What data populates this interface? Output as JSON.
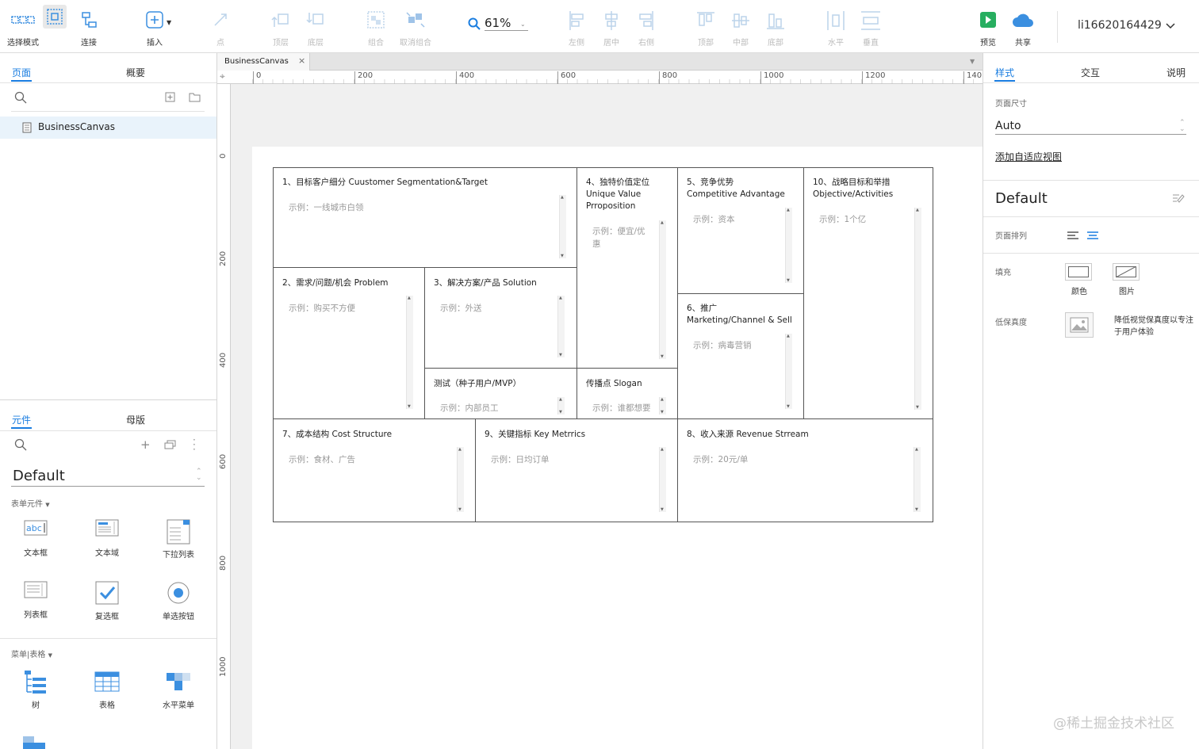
{
  "toolbar": {
    "select_mode": "选择模式",
    "connect": "连接",
    "insert": "插入",
    "point": "点",
    "top_layer": "顶层",
    "bottom_layer": "底层",
    "group": "组合",
    "ungroup": "取消组合",
    "zoom": "61%",
    "align_left": "左侧",
    "align_center": "居中",
    "align_right": "右侧",
    "align_top": "顶部",
    "align_middle": "中部",
    "align_bottom": "底部",
    "distribute_h": "水平",
    "distribute_v": "垂直",
    "preview": "预览",
    "share": "共享",
    "username": "li16620164429"
  },
  "left_panel": {
    "tabs": {
      "pages": "页面",
      "outline": "概要"
    },
    "page_item": "BusinessCanvas",
    "lib_tabs": {
      "widgets": "元件",
      "masters": "母版"
    },
    "library_name": "Default",
    "section_form": "表单元件",
    "widgets_form": [
      {
        "label": "文本框"
      },
      {
        "label": "文本域"
      },
      {
        "label": "下拉列表"
      },
      {
        "label": "列表框"
      },
      {
        "label": "复选框"
      },
      {
        "label": "单选按钮"
      }
    ],
    "section_menu": "菜单|表格",
    "widgets_menu": [
      {
        "label": "树"
      },
      {
        "label": "表格"
      },
      {
        "label": "水平菜单"
      }
    ]
  },
  "canvas": {
    "tab_title": "BusinessCanvas",
    "ruler_h": [
      "0",
      "200",
      "400",
      "600",
      "800",
      "1000",
      "1200",
      "140"
    ],
    "ruler_v": [
      "0",
      "200",
      "400",
      "600",
      "800",
      "1000"
    ],
    "cells": {
      "c1": {
        "title": "1、目标客户细分 Cuustomer Segmentation&Target",
        "sample": "示例：一线城市白领"
      },
      "c2": {
        "title": "2、需求/问题/机会 Problem",
        "sample": "示例：购买不方便"
      },
      "c3": {
        "title": "3、解决方案/产品 Solution",
        "sample": "示例：外送"
      },
      "c4": {
        "title": "4、独特价值定位\nUnique Value\nPrroposition",
        "sample": "示例：便宜/优\n惠"
      },
      "c5": {
        "title": "5、竞争优势\nCompetitive Advantage",
        "sample": "示例：资本"
      },
      "c6": {
        "title": "6、推广\nMarketing/Channel & Sell",
        "sample": "示例：病毒营销"
      },
      "c7": {
        "title": "7、成本结构 Cost Structure",
        "sample": "示例：食材、广告"
      },
      "c8": {
        "title": "8、收入来源 Revenue Strream",
        "sample": "示例：20元/单"
      },
      "c9": {
        "title": "9、关键指标 Key Metrrics",
        "sample": "示例：日均订单"
      },
      "c10": {
        "title": "10、战略目标和举措\nObjective/Activities",
        "sample": "示例：1个亿"
      },
      "mvp": {
        "title": "测试（种子用户/MVP）",
        "sample": "示例：内部员工"
      },
      "slogan": {
        "title": "传播点 Slogan",
        "sample": "示例：谁都想要"
      }
    }
  },
  "right_panel": {
    "tabs": {
      "style": "样式",
      "interact": "交互",
      "notes": "说明"
    },
    "page_size_label": "页面尺寸",
    "page_size_value": "Auto",
    "adaptive_link": "添加自适应视图",
    "style_name": "Default",
    "page_align_label": "页面排列",
    "fill_label": "填充",
    "fill_color": "颜色",
    "fill_image": "图片",
    "low_fidelity_label": "低保真度",
    "low_fidelity_desc": "降低视觉保真度以专注\n于用户体验"
  },
  "watermark": "@稀土掘金技术社区",
  "colors": {
    "accent": "#1a7de0",
    "preview_green": "#27ae60",
    "icon_blue": "#3b8fe0"
  }
}
